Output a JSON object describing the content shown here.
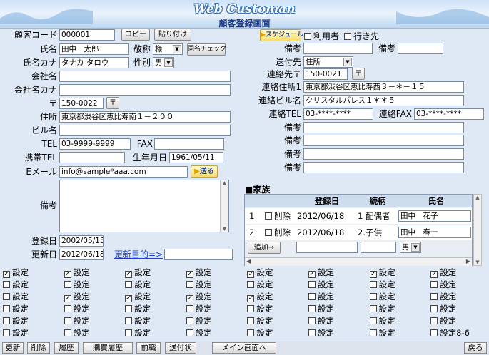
{
  "header": {
    "title": "Web Customan",
    "subtitle": "顧客登録画面"
  },
  "left": {
    "code_label": "顧客コード",
    "code_value": "000001",
    "copy_btn": "コピー",
    "paste_btn": "貼り付け",
    "name_label": "氏名",
    "name_value": "田中　太郎",
    "honorific_label": "敬称",
    "honorific_value": "様",
    "same_name_btn": "同名チェック",
    "kana_label": "氏名カナ",
    "kana_value": "タナカ タロウ",
    "gender_label": "性別",
    "gender_value": "男",
    "company_label": "会社名",
    "company_kana_label": "会社名カナ",
    "zip_label": "〒",
    "zip_value": "150-0022",
    "zip_btn": "〒",
    "address_label": "住所",
    "address_value": "東京都渋谷区恵比寿南１－２００",
    "building_label": "ビル名",
    "tel_label": "TEL",
    "tel_value": "03-9999-9999",
    "fax_label": "FAX",
    "mobile_label": "携帯TEL",
    "birth_label": "生年月日",
    "birth_value": "1961/05/11",
    "email_label": "Eメール",
    "email_value": "info@sample*aaa.com",
    "send_btn": "送る",
    "memo_label": "備考",
    "reg_label": "登録日",
    "reg_value": "2002/05/15",
    "upd_label": "更新日",
    "upd_value": "2012/06/18",
    "upd_purpose_link": "更新目的=>"
  },
  "right": {
    "schedule_btn": "スケジュール",
    "user_label": "利用者",
    "dest_label": "行き先",
    "memo1_label": "備考",
    "memo2_label": "備考",
    "sendto_label": "送付先",
    "sendto_value": "住所",
    "contact_zip_label": "連絡先〒",
    "contact_zip_value": "150-0021",
    "contact_zip_btn": "〒",
    "contact_addr_label": "連絡住所1",
    "contact_addr_value": "東京都渋谷区恵比寿西３－＊－１５",
    "contact_bld_label": "連絡ビル名",
    "contact_bld_value": "クリスタルパレス１＊＊５",
    "contact_tel_label": "連絡TEL",
    "contact_tel_value": "03-****-****",
    "contact_fax_label": "連絡FAX",
    "contact_fax_value": "03-****-****",
    "memo_labels": [
      "備考",
      "備考",
      "備考",
      "備考"
    ]
  },
  "family": {
    "title": "■家族",
    "headers": [
      "登録日",
      "続柄",
      "氏名"
    ],
    "rows": [
      {
        "no": "1",
        "del": "削除",
        "date": "2012/06/18",
        "rel": "1 配偶者",
        "name": "田中　花子"
      },
      {
        "no": "2",
        "del": "削除",
        "date": "2012/06/18",
        "rel": "2.子供",
        "name": "田中　春一"
      }
    ],
    "add_btn": "追加→",
    "new_gender": "男"
  },
  "checkboxes": {
    "label": "設定",
    "last_label": "設定8-6",
    "checked_row0": true,
    "checked_extra": [
      [
        1,
        2
      ],
      [
        2,
        2
      ],
      [
        3,
        2
      ],
      [
        4,
        2
      ]
    ]
  },
  "footer": {
    "buttons": [
      "更新",
      "削除",
      "履歴",
      "購買履歴",
      "前職",
      "送付状",
      "メイン画面へ"
    ],
    "back": "戻る"
  },
  "colors": {
    "accent": "#1f3c8a",
    "link": "#1a3fc9",
    "title_outline": "#3a6fb0"
  }
}
